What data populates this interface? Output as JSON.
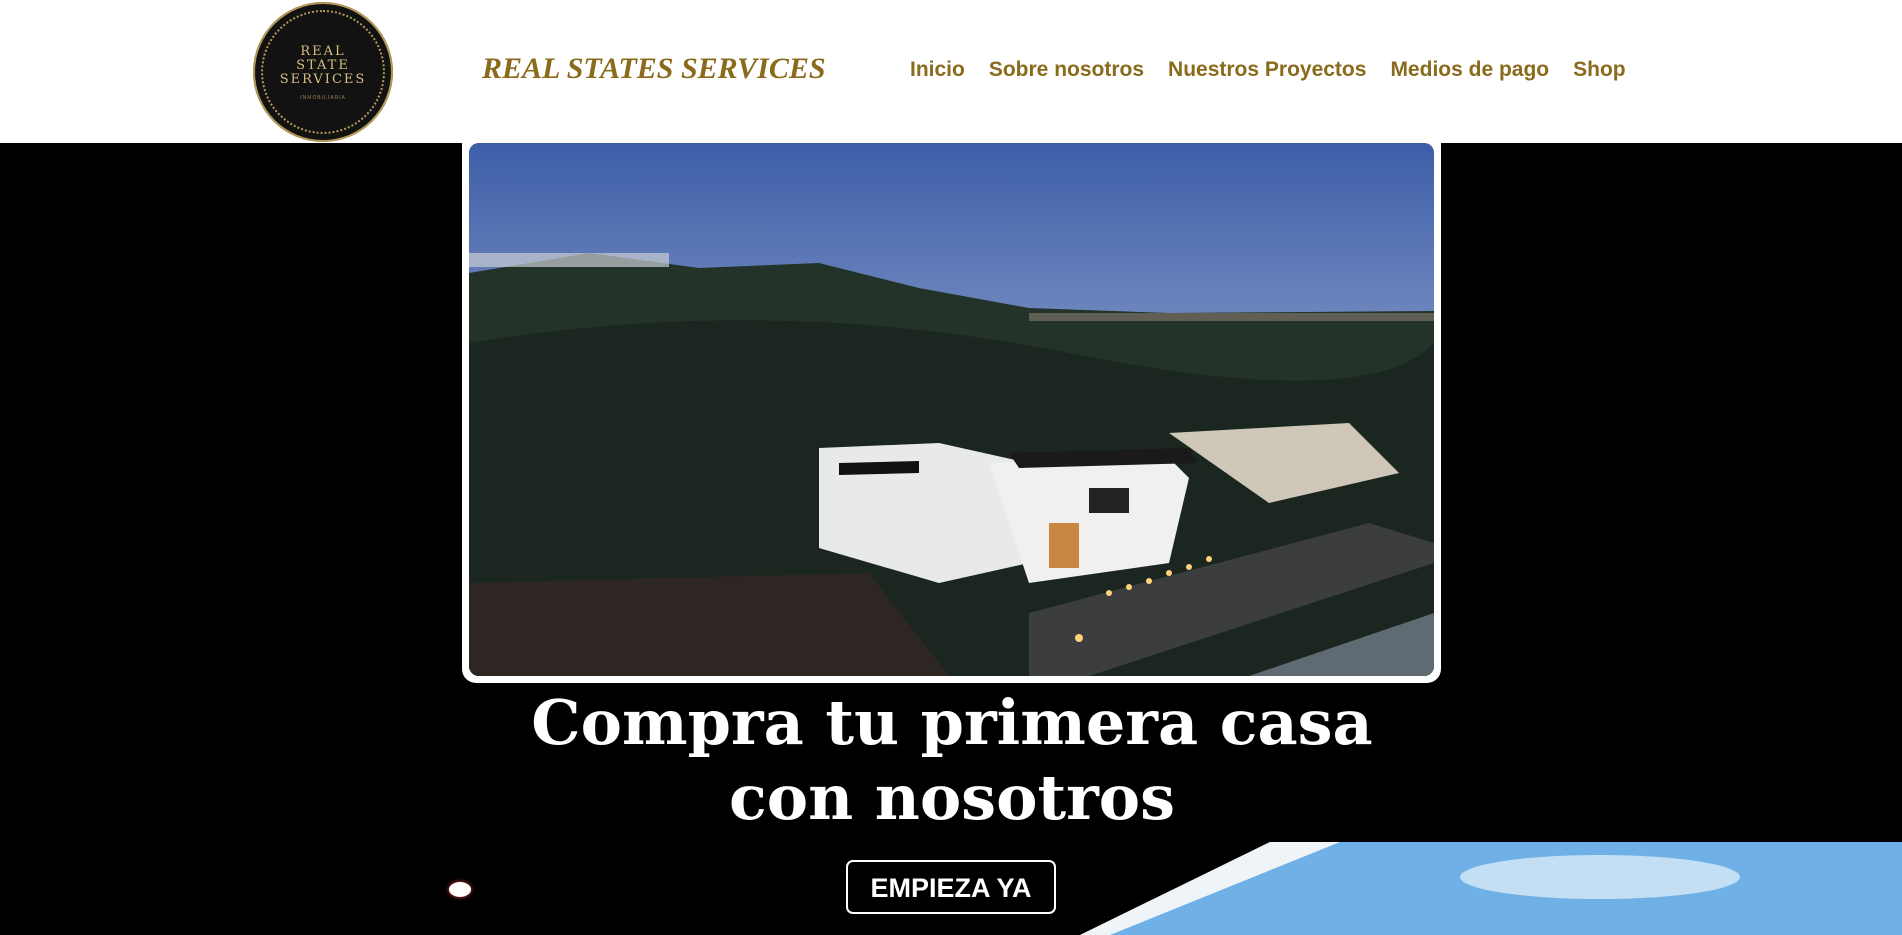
{
  "header": {
    "logo": {
      "line1": "REAL",
      "line2": "STATE",
      "line3": "SERVICES",
      "tagline": "INMOBILIARIA"
    },
    "brand": "REAL STATES SERVICES",
    "nav": [
      "Inicio",
      "Sobre nosotros",
      "Nuestros Proyectos",
      "Medios de pago",
      "Shop"
    ]
  },
  "hero": {
    "headline_line1": "Compra tu primera casa",
    "headline_line2": "con nosotros",
    "cta_label": "EMPIEZA YA"
  },
  "colors": {
    "accent": "#8a6a1b",
    "background": "#000000",
    "text": "#ffffff"
  }
}
